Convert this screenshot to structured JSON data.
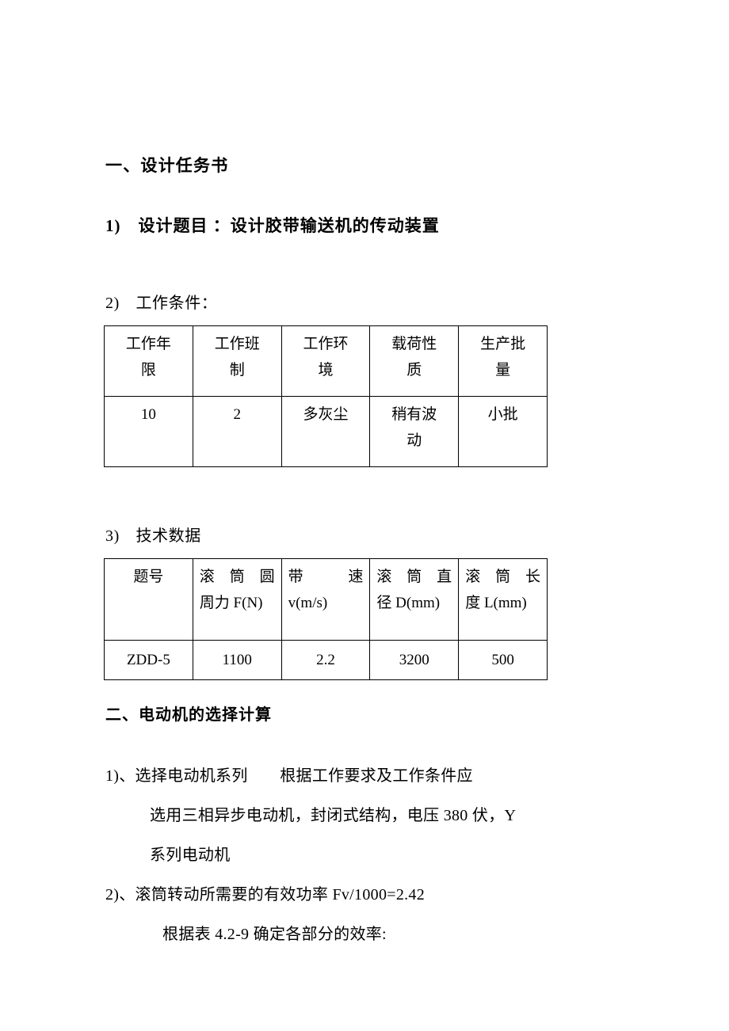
{
  "document": {
    "title": "设计任务书",
    "background_color": "#ffffff",
    "text_color": "#000000",
    "border_color": "#000000"
  },
  "section_one": {
    "heading": "一、设计任务书",
    "item_1": "1)　设计题目 ：设计胶带输送机的传动装置",
    "item_2": "2)　工作条件：",
    "item_3": "3)　技术数据"
  },
  "working_conditions_table": {
    "headers": [
      {
        "line1": "工作年",
        "line2": "限"
      },
      {
        "line1": "工作班",
        "line2": "制"
      },
      {
        "line1": "工作环",
        "line2": "境"
      },
      {
        "line1": "载荷性",
        "line2": "质"
      },
      {
        "line1": "生产批",
        "line2": "量"
      }
    ],
    "rows": [
      [
        {
          "line1": "10",
          "line2": ""
        },
        {
          "line1": "2",
          "line2": ""
        },
        {
          "line1": "多灰尘",
          "line2": ""
        },
        {
          "line1": "稍有波",
          "line2": "动"
        },
        {
          "line1": "小批",
          "line2": ""
        }
      ]
    ]
  },
  "technical_data_table": {
    "headers": [
      {
        "line1": "题号",
        "line2": ""
      },
      {
        "line1": "滚筒圆",
        "line2": "周力 F(N)"
      },
      {
        "line1": "带　　速",
        "line2": "v(m/s)"
      },
      {
        "line1": "滚筒直",
        "line2": "径 D(mm)"
      },
      {
        "line1": "滚筒长",
        "line2": "度 L(mm)"
      }
    ],
    "rows": [
      [
        "ZDD-5",
        "1100",
        "2.2",
        "3200",
        "500"
      ]
    ]
  },
  "section_two": {
    "heading": "二、电动机的选择计算",
    "paragraph_1": {
      "line1": "1)、选择电动机系列　　根据工作要求及工作条件应",
      "line2": "选用三相异步电动机，封闭式结构，电压 380 伏，Y",
      "line3": "系列电动机"
    },
    "paragraph_2": {
      "line1": "2)、滚筒转动所需要的有效功率 Fv/1000=2.42",
      "line2": "根据表 4.2-9 确定各部分的效率:"
    }
  }
}
